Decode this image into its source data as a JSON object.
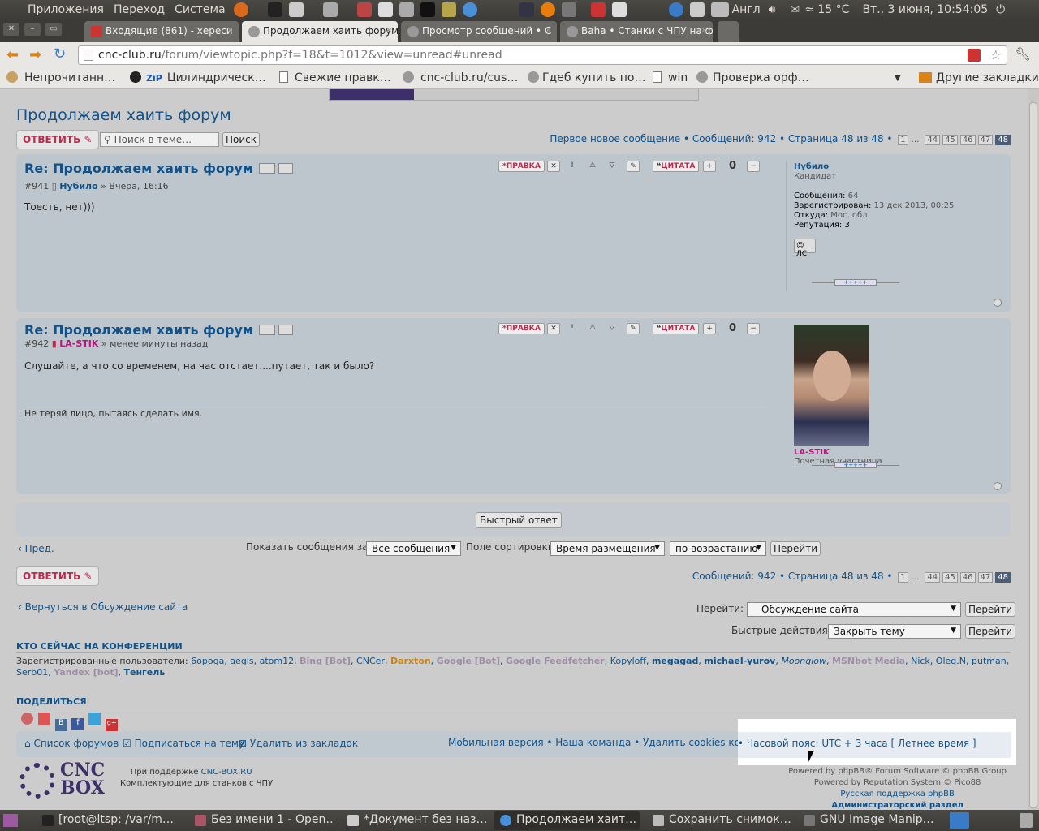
{
  "topbar": {
    "menu": [
      "Приложения",
      "Переход",
      "Система"
    ],
    "lang": "Англ",
    "weather": "≈ 15 °C",
    "datetime": "Вт., 3 июня, 10:54:05"
  },
  "tabs": [
    {
      "title": "Входящие (861) - хереси"
    },
    {
      "title": "Продолжаем хаить форум"
    },
    {
      "title": "Просмотр сообщений • С"
    },
    {
      "title": "Baha • Станки с ЧПУ на ф"
    }
  ],
  "url": {
    "domain": "cnc-club.ru",
    "path": "/forum/viewtopic.php?f=18&t=1012&view=unread#unread"
  },
  "bookmarks": [
    {
      "label": "Непрочитанн…"
    },
    {
      "label": "Цилиндрическ…"
    },
    {
      "label": "Свежие правк…"
    },
    {
      "label": "cnc-club.ru/cus…"
    },
    {
      "label": "Гдеб купить по…"
    },
    {
      "label": "win"
    },
    {
      "label": "Проверка орф…"
    }
  ],
  "bookmarks_other": "Другие закладки",
  "page": {
    "title": "Продолжаем хаить форум",
    "reply_label": "ОТВЕТИТЬ",
    "search_placeholder": "Поиск в теме…",
    "search_button": "Поиск",
    "pagination_top": "Первое новое сообщение • Сообщений: 942 • Страница 48 из 48 •",
    "pagination_bottom": "Сообщений: 942 • Страница 48 из 48 •",
    "pages": [
      "1",
      "…",
      "44",
      "45",
      "46",
      "47",
      "48"
    ]
  },
  "posts": [
    {
      "subject": "Re: Продолжаем хаить форум",
      "number": "#941",
      "author": "Нубило",
      "time": "» Вчера, 16:16",
      "body": "Тоесть, нет)))",
      "edit": "ПРАВКА",
      "quote": "ЦИТАТА",
      "rating": "0",
      "profile": {
        "name": "Нубило",
        "rank": "Кандидат",
        "posts_label": "Сообщения:",
        "posts": "64",
        "reg_label": "Зарегистрирован:",
        "reg": "13 дек 2013, 00:25",
        "from_label": "Откуда:",
        "from": "Мос. обл.",
        "rep_label": "Репутация:",
        "rep": "3",
        "pm": "ЛС"
      }
    },
    {
      "subject": "Re: Продолжаем хаить форум",
      "number": "#942",
      "author": "LA-STIK",
      "time": "» менее минуты назад",
      "body": "Слушайте, а что со временем, на час отстает....путает, так и было?",
      "signature": "Не теряй лицо, пытаясь сделать имя.",
      "edit": "ПРАВКА",
      "quote": "ЦИТАТА",
      "rating": "0",
      "profile": {
        "name": "LA-STIK",
        "rank": "Почетная участница"
      }
    }
  ],
  "quick_reply": "Быстрый ответ",
  "prev": "Пред.",
  "filter": {
    "show_label": "Показать сообщения за:",
    "show_value": "Все сообщения",
    "sort_label": "Поле сортировки",
    "sort_value": "Время размещения",
    "order_value": "по возрастанию",
    "go": "Перейти"
  },
  "back_link": "Вернуться в Обсуждение сайта",
  "jump": {
    "label": "Перейти:",
    "value": "Обсуждение сайта",
    "go": "Перейти"
  },
  "quick_actions": {
    "label": "Быстрые действия:",
    "value": "Закрыть тему",
    "go": "Перейти"
  },
  "online": {
    "title": "КТО СЕЙЧАС НА КОНФЕРЕНЦИИ",
    "label": "Зарегистрированные пользователи:",
    "users": [
      "6opoga",
      "aegis",
      "atom12",
      "Bing [Bot]",
      "CNCer",
      "Darxton",
      "Google [Bot]",
      "Google Feedfetcher",
      "Kopyloff",
      "megagad",
      "michael-yurov",
      "Moonglow",
      "MSNbot Media",
      "Nick",
      "Oleg.N",
      "putman",
      "Serb01",
      "Yandex [bot]",
      "Тенгель"
    ]
  },
  "share": {
    "title": "ПОДЕЛИТЬСЯ"
  },
  "footer": {
    "index": "Список форумов",
    "subscribe": "Подписаться на тему",
    "remove_bookmark": "Удалить из закладок",
    "mobile": "Мобильная версия",
    "team": "Наша команда",
    "cookies": "Удалить cookies конференции",
    "timezone": "Часовой пояс: UTC + 3 часа [ Летнее время ]"
  },
  "logo": {
    "line1": "CNC",
    "line2": "BOX"
  },
  "support": {
    "text": "При поддержке",
    "link": "CNC-BOX.RU",
    "sub": "Комплектующие для станков с ЧПУ"
  },
  "powered": {
    "line1": "Powered by phpBB® Forum Software © phpBB Group",
    "line2": "Powered by Reputation System © Pico88",
    "line3": "Русская поддержка phpBB",
    "line4": "Администраторский раздел"
  },
  "taskbar": [
    {
      "label": "[root@ltsp: /var/m…"
    },
    {
      "label": "Без имени 1 - Open…"
    },
    {
      "label": "*Документ без наз…"
    },
    {
      "label": "Продолжаем хаит…"
    },
    {
      "label": "Сохранить снимок…"
    },
    {
      "label": "GNU Image Manip…"
    }
  ]
}
